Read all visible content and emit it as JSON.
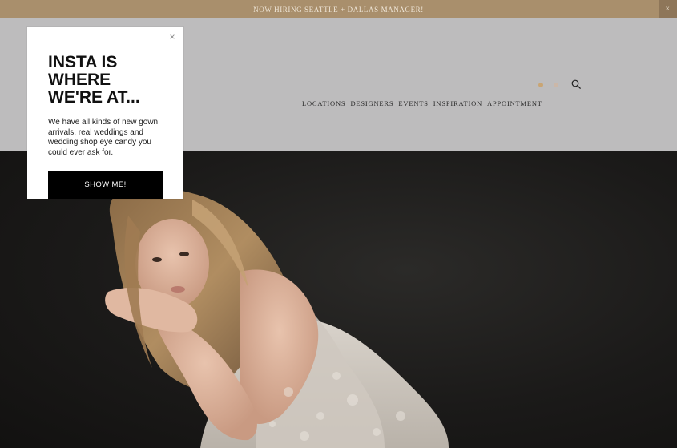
{
  "announcement": {
    "text": "NOW HIRING SEATTLE + DALLAS MANAGER!",
    "close_label": "×"
  },
  "nav": {
    "items": [
      {
        "label": "LOCATIONS"
      },
      {
        "label": "DESIGNERS"
      },
      {
        "label": "EVENTS"
      },
      {
        "label": "INSPIRATION"
      },
      {
        "label": "APPOINTMENT"
      }
    ]
  },
  "icons": {
    "search": "search-icon",
    "social_1": "social-dot-icon",
    "social_2": "social-dot-icon"
  },
  "popup": {
    "close_label": "×",
    "title": "INSTA IS\nWHERE\nWE'RE AT...",
    "text": "We have all kinds of new gown arrivals, real weddings and wedding shop eye candy you could ever ask for.",
    "button_label": "SHOW ME!"
  },
  "colors": {
    "announcement_bg": "#a98f6c",
    "accent_dot_1": "#c9a574",
    "accent_dot_2": "#cbb7a8",
    "button_bg": "#000000"
  }
}
